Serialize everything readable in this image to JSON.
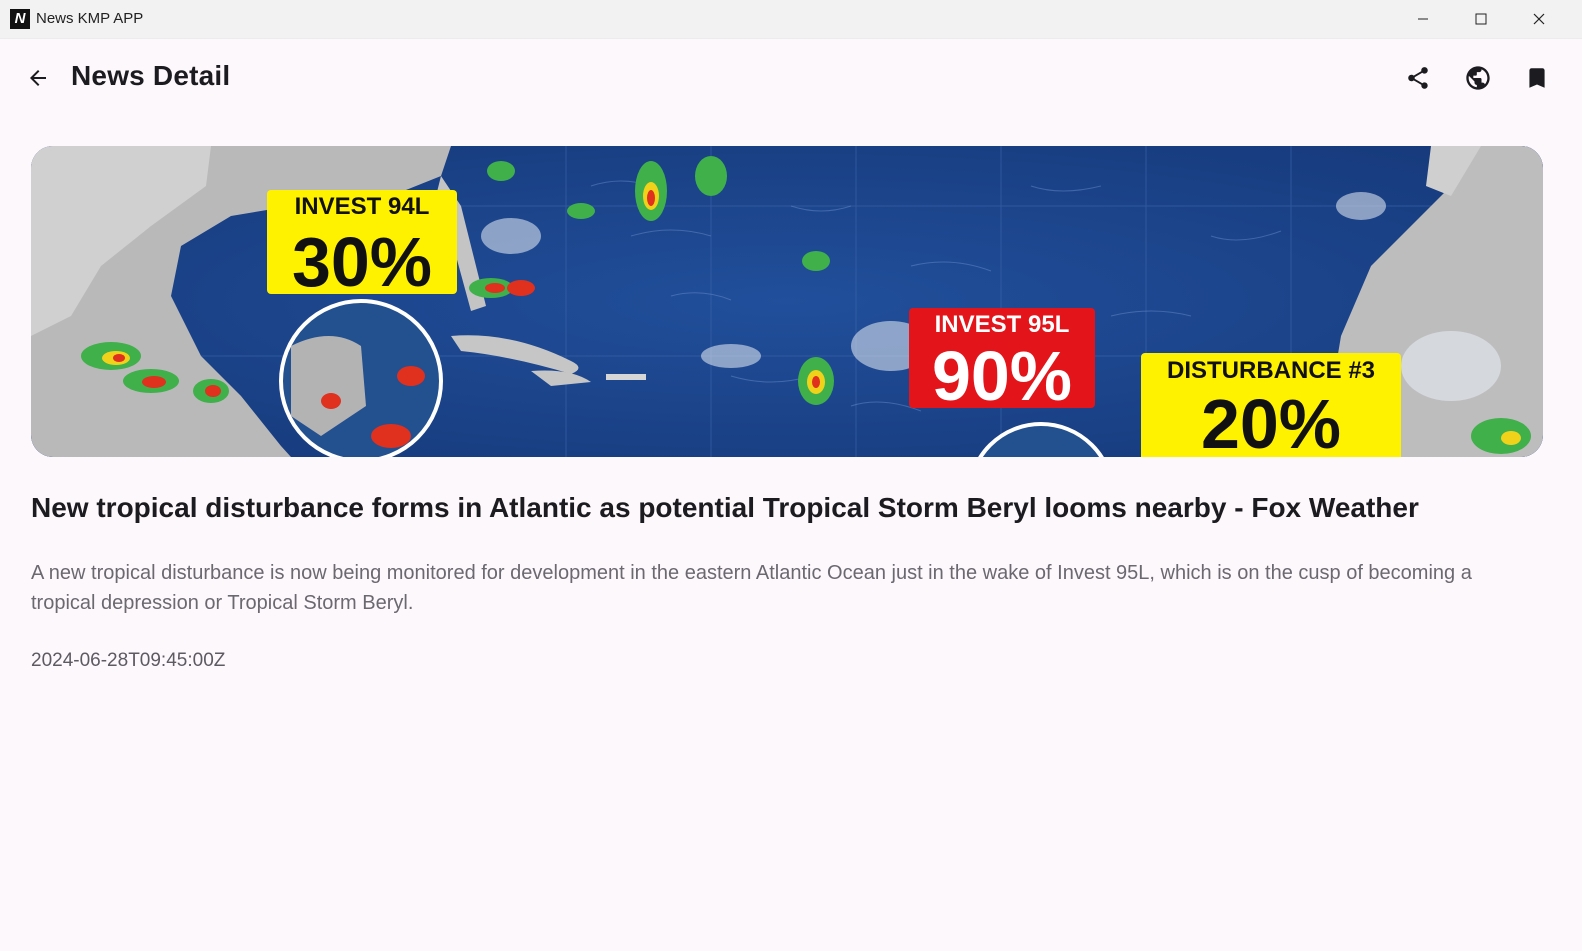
{
  "window": {
    "title": "News KMP APP",
    "logo_letter": "N"
  },
  "appbar": {
    "title": "News Detail"
  },
  "hero_image": {
    "alt": "Tropical outlook map",
    "labels": {
      "invest94_name": "INVEST 94L",
      "invest94_pct": "30%",
      "invest95_name": "INVEST 95L",
      "invest95_pct": "90%",
      "dist3_name": "DISTURBANCE #3",
      "dist3_pct": "20%"
    },
    "colors": {
      "ocean": "#1b4a92",
      "land": "#c9c9c9",
      "yellow_label": "#fff200",
      "red_label": "#e3151a"
    }
  },
  "article": {
    "headline": "New tropical disturbance forms in Atlantic as potential Tropical Storm Beryl looms nearby - Fox Weather",
    "description": "A new tropical disturbance is now being monitored for development in the eastern Atlantic Ocean just in the wake of Invest 95L, which is on the cusp of becoming a tropical depression or Tropical Storm Beryl.",
    "published_at": "2024-06-28T09:45:00Z"
  }
}
